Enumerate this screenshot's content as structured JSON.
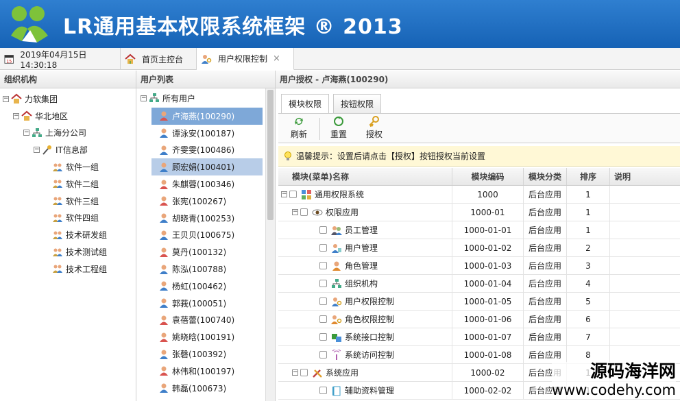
{
  "app": {
    "title": "LR通用基本权限系统框架 ® 2013",
    "accent": "#1e6fc4"
  },
  "tabs": {
    "datetime": "2019年04月15日 14:30:18",
    "home": "首页主控台",
    "perm": "用户权限控制",
    "close": "×"
  },
  "org": {
    "header": "组织机构",
    "nodes": [
      {
        "label": "力软集团",
        "icon": "home-icon",
        "indent": 0,
        "expand": "−"
      },
      {
        "label": "华北地区",
        "icon": "home-icon",
        "indent": 1,
        "expand": "−"
      },
      {
        "label": "上海分公司",
        "icon": "org-icon",
        "indent": 2,
        "expand": "−"
      },
      {
        "label": "IT信息部",
        "icon": "key-icon",
        "indent": 3,
        "expand": "−"
      },
      {
        "label": "软件一组",
        "icon": "group-icon",
        "indent": 4
      },
      {
        "label": "软件二组",
        "icon": "group-icon",
        "indent": 4
      },
      {
        "label": "软件三组",
        "icon": "group-icon",
        "indent": 4
      },
      {
        "label": "软件四组",
        "icon": "group-icon",
        "indent": 4
      },
      {
        "label": "技术研发组",
        "icon": "group-icon",
        "indent": 4
      },
      {
        "label": "技术测试组",
        "icon": "group-icon",
        "indent": 4
      },
      {
        "label": "技术工程组",
        "icon": "group-icon",
        "indent": 4
      }
    ]
  },
  "users": {
    "header": "用户列表",
    "root": "所有用户",
    "items": [
      {
        "name": "卢海燕(100290)",
        "state": "sel",
        "g": "f"
      },
      {
        "name": "谭泳安(100187)",
        "g": "m"
      },
      {
        "name": "齐雯雯(100486)",
        "g": "m"
      },
      {
        "name": "顾宏娟(100401)",
        "state": "sel2",
        "g": "m"
      },
      {
        "name": "朱麒蓉(100346)",
        "g": "f"
      },
      {
        "name": "张宪(100267)",
        "g": "f"
      },
      {
        "name": "胡晓青(100253)",
        "g": "m"
      },
      {
        "name": "王贝贝(100675)",
        "g": "m"
      },
      {
        "name": "莫丹(100132)",
        "g": "f"
      },
      {
        "name": "陈泓(100788)",
        "g": "m"
      },
      {
        "name": "杨虹(100462)",
        "g": "m"
      },
      {
        "name": "郭莪(100051)",
        "g": "m"
      },
      {
        "name": "袁蓓蕾(100740)",
        "g": "f"
      },
      {
        "name": "姚晓晗(100191)",
        "g": "f"
      },
      {
        "name": "张磬(100392)",
        "g": "m"
      },
      {
        "name": "林伟和(100197)",
        "g": "f"
      },
      {
        "name": "韩磊(100673)",
        "g": "m"
      }
    ]
  },
  "auth": {
    "header": "用户授权 - 卢海燕(100290)",
    "subtabs": [
      "模块权限",
      "按钮权限"
    ],
    "toolbar": {
      "refresh": "刷新",
      "reset": "重置",
      "grant": "授权"
    },
    "tip": "温馨提示：设置后请点击【授权】按钮授权当前设置",
    "columns": {
      "name": "模块(菜单)名称",
      "code": "模块编码",
      "cat": "模块分类",
      "sort": "排序",
      "desc": "说明"
    },
    "rows": [
      {
        "name": "通用权限系统",
        "code": "1000",
        "cat": "后台应用",
        "sort": "1",
        "level": 0,
        "expand": "−",
        "icon": "app-grid-icon"
      },
      {
        "name": "权限应用",
        "code": "1000-01",
        "cat": "后台应用",
        "sort": "1",
        "level": 1,
        "expand": "−",
        "icon": "eye-icon"
      },
      {
        "name": "员工管理",
        "code": "1000-01-01",
        "cat": "后台应用",
        "sort": "1",
        "level": 2,
        "icon": "staff-icon"
      },
      {
        "name": "用户管理",
        "code": "1000-01-02",
        "cat": "后台应用",
        "sort": "2",
        "level": 2,
        "icon": "user-manage-icon"
      },
      {
        "name": "角色管理",
        "code": "1000-01-03",
        "cat": "后台应用",
        "sort": "3",
        "level": 2,
        "icon": "role-icon"
      },
      {
        "name": "组织机构",
        "code": "1000-01-04",
        "cat": "后台应用",
        "sort": "4",
        "level": 2,
        "icon": "org-icon"
      },
      {
        "name": "用户权限控制",
        "code": "1000-01-05",
        "cat": "后台应用",
        "sort": "5",
        "level": 2,
        "icon": "user-key-icon"
      },
      {
        "name": "角色权限控制",
        "code": "1000-01-06",
        "cat": "后台应用",
        "sort": "6",
        "level": 2,
        "icon": "role-key-icon"
      },
      {
        "name": "系统接口控制",
        "code": "1000-01-07",
        "cat": "后台应用",
        "sort": "7",
        "level": 2,
        "icon": "interface-icon"
      },
      {
        "name": "系统访问控制",
        "code": "1000-01-08",
        "cat": "后台应用",
        "sort": "8",
        "level": 2,
        "icon": "antenna-icon"
      },
      {
        "name": "系统应用",
        "code": "1000-02",
        "cat": "后台应用",
        "sort": "1",
        "level": 1,
        "expand": "−",
        "icon": "tools-icon"
      },
      {
        "name": "辅助资料管理",
        "code": "1000-02-02",
        "cat": "后台应用",
        "sort": "1",
        "level": 2,
        "icon": "book-icon"
      }
    ]
  },
  "watermark": {
    "line1": "源码海洋网",
    "line2": "www.codehy.com"
  }
}
